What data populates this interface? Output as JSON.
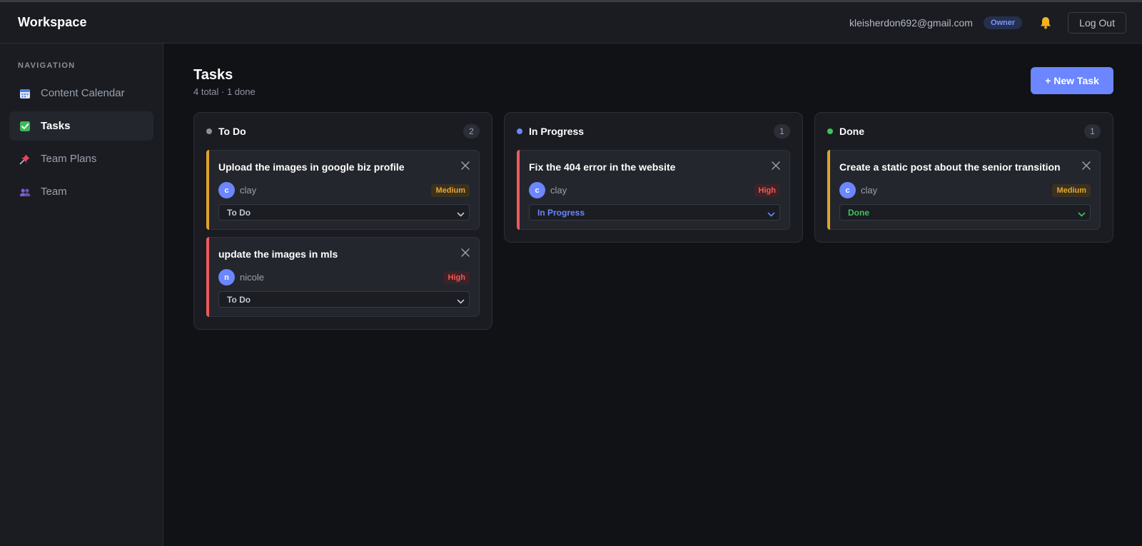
{
  "app": {
    "brand": "Workspace",
    "user_email": "kleisherdon692@gmail.com",
    "role": "Owner",
    "logout_label": "Log Out"
  },
  "sidebar": {
    "heading": "NAVIGATION",
    "items": [
      {
        "label": "Content Calendar",
        "icon": "calendar-icon",
        "active": false
      },
      {
        "label": "Tasks",
        "icon": "checkbox-icon",
        "active": true
      },
      {
        "label": "Team Plans",
        "icon": "pushpin-icon",
        "active": false
      },
      {
        "label": "Team",
        "icon": "people-icon",
        "active": false
      }
    ]
  },
  "main": {
    "title": "Tasks",
    "subtitle": "4 total · 1 done",
    "new_task_label": "+ New Task"
  },
  "columns": [
    {
      "title": "To Do",
      "count": "2",
      "dot_color": "#8b8f99",
      "cards": [
        {
          "title": "Upload the images in google biz profile",
          "avatar": "c",
          "assignee": "clay",
          "priority": "Medium",
          "status": "To Do",
          "accent": "#e0a32a"
        },
        {
          "title": "update the images in mls",
          "avatar": "n",
          "assignee": "nicole",
          "priority": "High",
          "status": "To Do",
          "accent": "#ee5a5a"
        }
      ]
    },
    {
      "title": "In Progress",
      "count": "1",
      "dot_color": "#6b86ff",
      "cards": [
        {
          "title": "Fix the 404 error in the website",
          "avatar": "c",
          "assignee": "clay",
          "priority": "High",
          "status": "In Progress",
          "accent": "#ee5a5a"
        }
      ]
    },
    {
      "title": "Done",
      "count": "1",
      "dot_color": "#3fc45a",
      "cards": [
        {
          "title": "Create a static post about the senior transition",
          "avatar": "c",
          "assignee": "clay",
          "priority": "Medium",
          "status": "Done",
          "accent": "#e0a32a"
        }
      ]
    }
  ],
  "colors": {
    "accent": "#6b86ff",
    "status_in_progress": "#6b86ff",
    "status_done": "#3fc45a"
  }
}
